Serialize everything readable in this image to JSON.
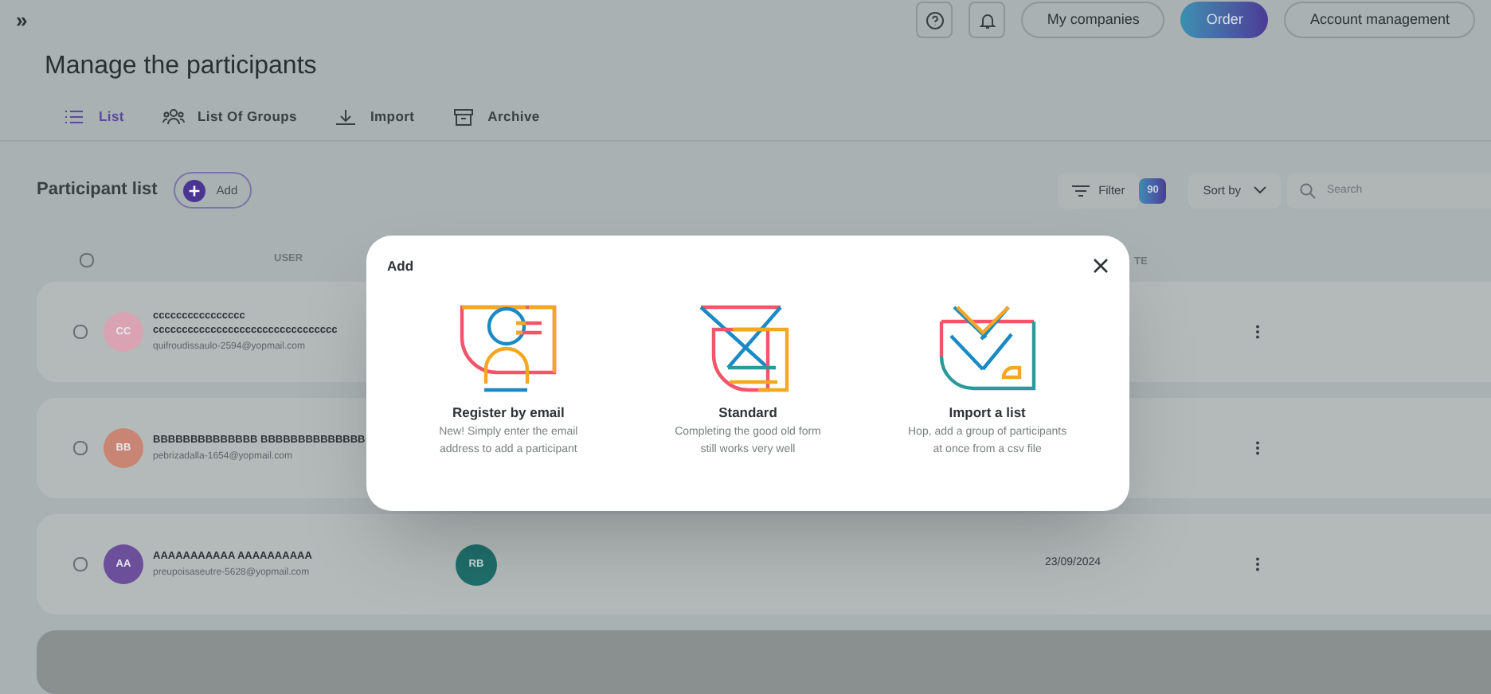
{
  "topbar": {
    "expand_icon": "»",
    "buttons": [
      {
        "label": "My companies",
        "kind": "outline"
      },
      {
        "label": "Order",
        "kind": "primary"
      },
      {
        "label": "Account management",
        "kind": "outline"
      }
    ]
  },
  "title": "Manage the participants",
  "tabs": [
    {
      "label": "List",
      "selected": true
    },
    {
      "label": "List Of Groups",
      "selected": false
    },
    {
      "label": "Import",
      "selected": false
    },
    {
      "label": "Archive",
      "selected": false
    }
  ],
  "select_all_checked": false,
  "list": {
    "title": "Participant list",
    "add_label": "Add",
    "filter_label": "Filter",
    "filter_count": "90",
    "sort_label": "Sort by",
    "search_placeholder": "Search"
  },
  "columns": [
    {
      "label": "USER"
    },
    {
      "label": "TE"
    }
  ],
  "rows": [
    {
      "initials": "CC",
      "color": "#d9a3b3",
      "name_lines": [
        "cccccccccccccccc",
        "cccccccccccccccccccccccccccccccc"
      ],
      "email": "quifroudissaulo-2594@yopmail.com",
      "checked": false
    },
    {
      "initials": "BB",
      "color": "#c98573",
      "name_lines": [
        "BBBBBBBBBBBBBB BBBBBBBBBBBBBB"
      ],
      "email": "pebrizadalla-1654@yopmail.com",
      "checked": false
    },
    {
      "initials": "AA",
      "color": "#6b4f9a",
      "name_lines": [
        "AAAAAAAAAAA AAAAAAAAAA"
      ],
      "email": "preupoisaseutre-5628@yopmail.com",
      "checked": false,
      "group": "RB",
      "date": "23/09/2024"
    }
  ],
  "modal": {
    "title": "Add",
    "options": [
      {
        "kind": "email",
        "title": "Register by email",
        "description": [
          "New! Simply enter the email",
          "address to add a participant"
        ]
      },
      {
        "kind": "standard",
        "title": "Standard",
        "description": [
          "Completing the good old form",
          "still works very well"
        ]
      },
      {
        "kind": "import",
        "title": "Import a list",
        "description": [
          "Hop, add a group of participants",
          "at once from a csv file"
        ]
      }
    ]
  }
}
